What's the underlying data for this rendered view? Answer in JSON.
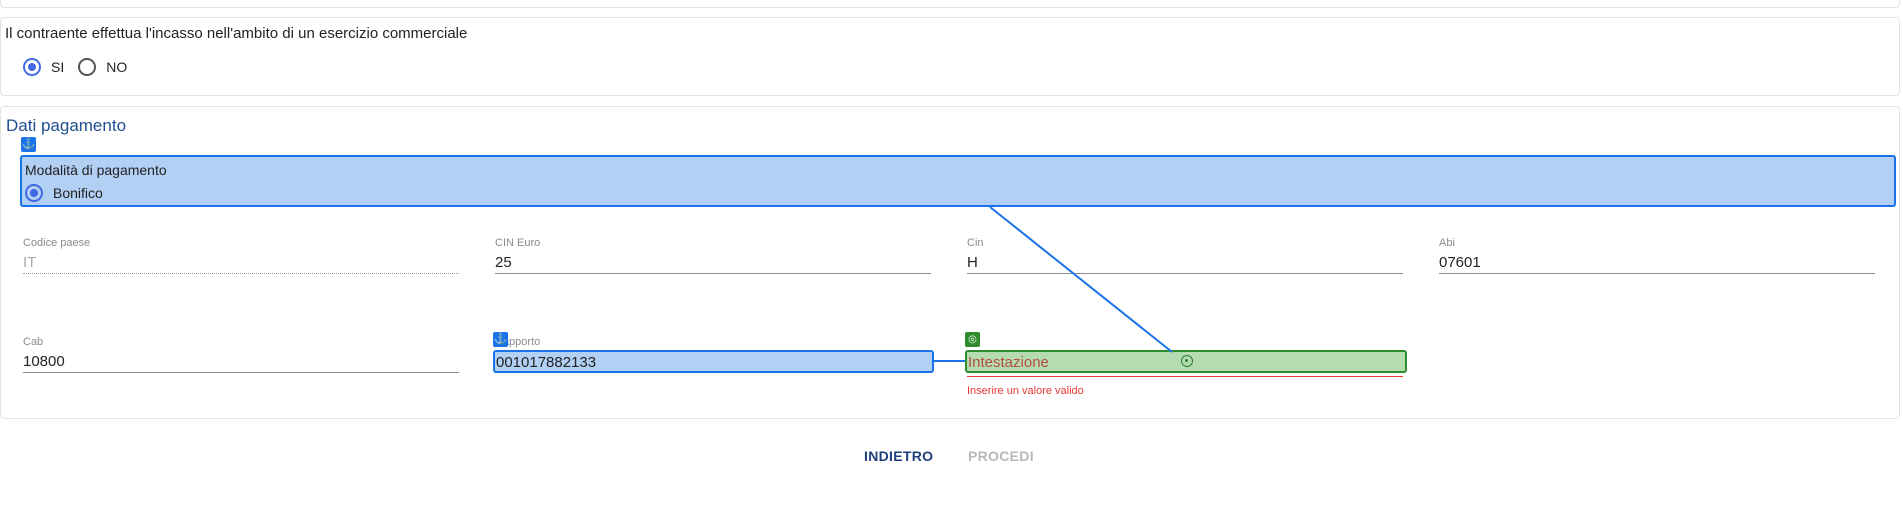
{
  "incasso": {
    "question": "Il contraente effettua l'incasso nell'ambito di un esercizio commerciale",
    "options": [
      {
        "label": "SI",
        "selected": true
      },
      {
        "label": "NO",
        "selected": false
      }
    ]
  },
  "pagamento": {
    "title": "Dati pagamento",
    "modalita": {
      "label": "Modalità di pagamento",
      "option": "Bonifico",
      "selected": true
    },
    "fields": {
      "codice_paese": {
        "label": "Codice paese",
        "value": "IT"
      },
      "cin_euro": {
        "label": "CIN Euro",
        "value": "25"
      },
      "cin": {
        "label": "Cin",
        "value": "H"
      },
      "abi": {
        "label": "Abi",
        "value": "07601"
      },
      "cab": {
        "label": "Cab",
        "value": "10800"
      },
      "rapporto": {
        "label": "Rapporto",
        "value": "001017882133"
      },
      "intestazione": {
        "placeholder": "Intestazione",
        "error": "Inserire un valore valido"
      }
    }
  },
  "buttons": {
    "back": "INDIETRO",
    "next": "PROCEDI"
  },
  "colors": {
    "accent": "#1a73e8",
    "radio": "#4169e1",
    "error": "#e53935",
    "target": "#2e8b2e"
  }
}
